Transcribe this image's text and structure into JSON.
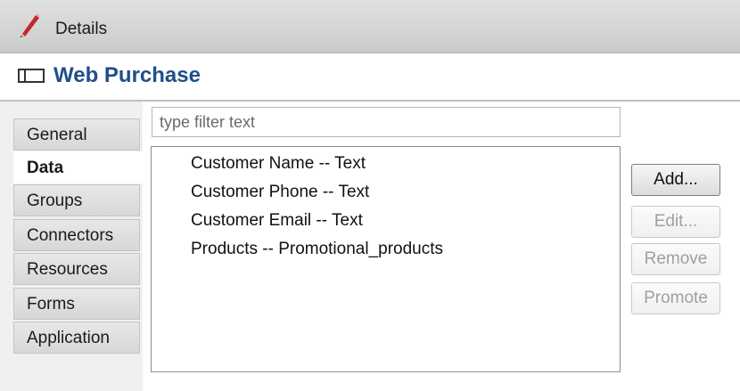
{
  "window": {
    "title": "Details",
    "icon": "pencil-icon"
  },
  "header": {
    "title": "Web Purchase",
    "icon": "panel-icon"
  },
  "sidebar": {
    "tabs": [
      {
        "label": "General",
        "active": false
      },
      {
        "label": "Data",
        "active": true
      },
      {
        "label": "Groups",
        "active": false
      },
      {
        "label": "Connectors",
        "active": false
      },
      {
        "label": "Resources",
        "active": false
      },
      {
        "label": "Forms",
        "active": false
      },
      {
        "label": "Application",
        "active": false
      }
    ]
  },
  "filter": {
    "placeholder": "type filter text",
    "value": ""
  },
  "list": {
    "items": [
      "Customer Name -- Text",
      "Customer Phone -- Text",
      "Customer Email -- Text",
      "Products -- Promotional_products"
    ]
  },
  "buttons": {
    "add": {
      "label": "Add...",
      "enabled": true
    },
    "edit": {
      "label": "Edit...",
      "enabled": false
    },
    "remove": {
      "label": "Remove",
      "enabled": false
    },
    "promote": {
      "label": "Promote",
      "enabled": false
    }
  },
  "colors": {
    "header_title": "#1f4f8a",
    "pencil_red": "#c0282d",
    "titlebar_bg": "#d4d4d4"
  }
}
